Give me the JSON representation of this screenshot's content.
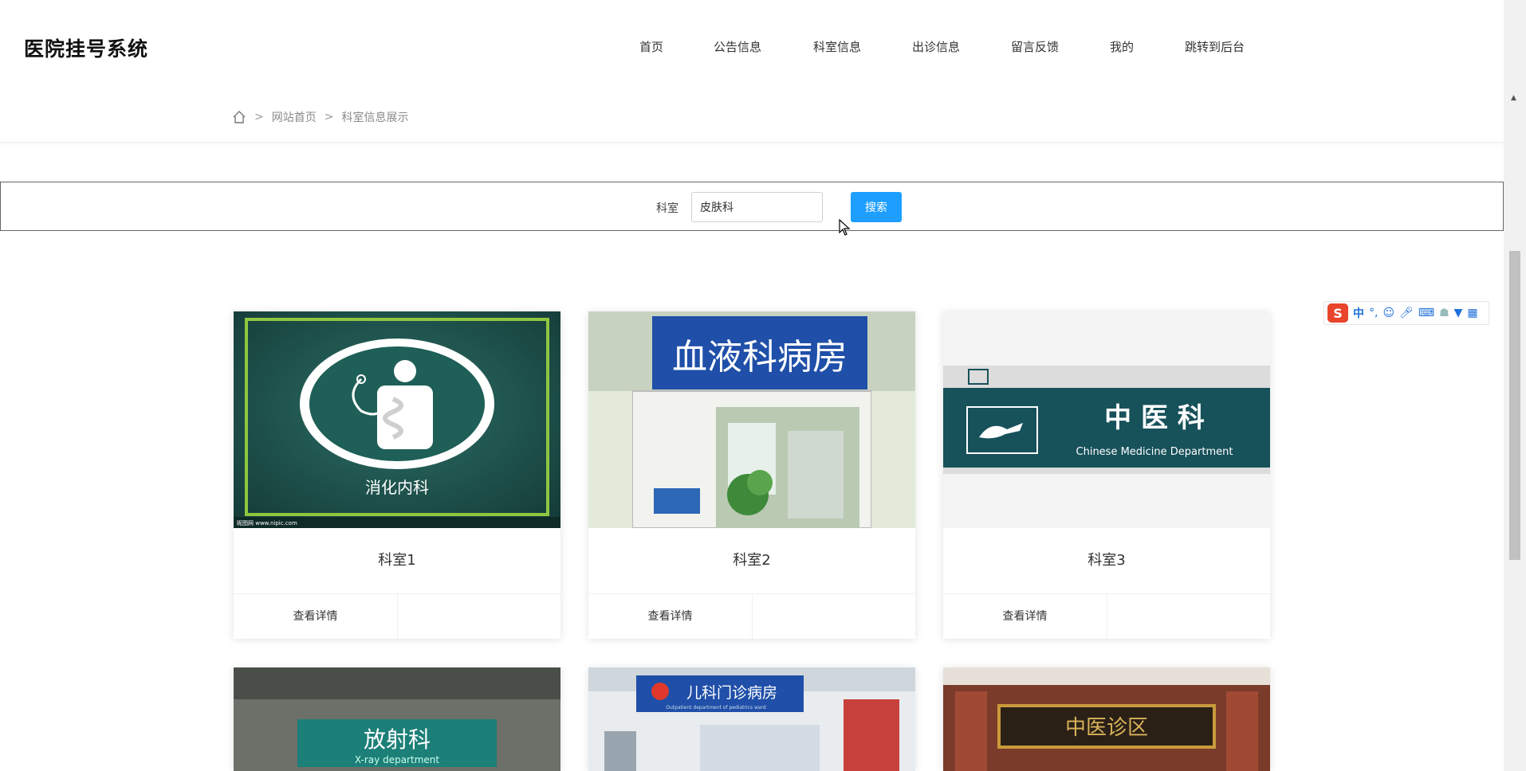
{
  "header": {
    "logo": "医院挂号系统",
    "nav": [
      "首页",
      "公告信息",
      "科室信息",
      "出诊信息",
      "留言反馈",
      "我的",
      "跳转到后台"
    ]
  },
  "breadcrumb": {
    "home_icon": "home-icon",
    "items": [
      "网站首页",
      "科室信息展示"
    ],
    "separator": ">"
  },
  "search": {
    "label": "科室",
    "value": "皮肤科",
    "button": "搜索"
  },
  "cards": [
    {
      "title": "科室1",
      "detail": "查看详情",
      "image_text": "消化内科",
      "image_watermark": "昵图网 www.nipic.com"
    },
    {
      "title": "科室2",
      "detail": "查看详情",
      "image_text": "血液科病房"
    },
    {
      "title": "科室3",
      "detail": "查看详情",
      "image_text": "中 医 科",
      "image_subtext": "Chinese Medicine Department"
    }
  ],
  "cards_row2": [
    {
      "image_text": "放射科",
      "image_subtext": "X-ray department"
    },
    {
      "image_text": "儿科门诊病房",
      "image_subtext": "Outpatient department of pediatrics ward"
    },
    {
      "image_text": "中医诊区"
    }
  ],
  "ime_toolbar": {
    "logo": "S",
    "mode": "中",
    "icons": [
      "punctuation-icon",
      "emoji-icon",
      "microphone-icon",
      "keyboard-icon",
      "skin-icon",
      "shirt-icon",
      "grid-icon"
    ]
  },
  "colors": {
    "accent": "#1e9fff",
    "card_green": "#1a4f48",
    "banner_blue": "#1f4fa8",
    "tcm_teal": "#17515a"
  }
}
